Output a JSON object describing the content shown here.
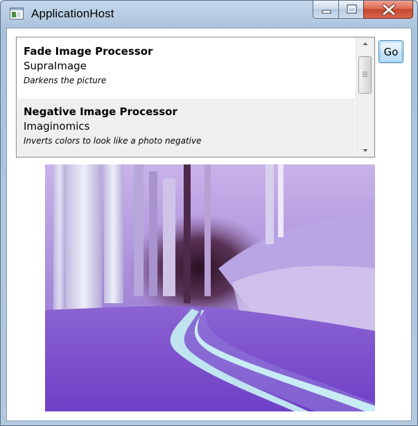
{
  "window": {
    "title": "ApplicationHost",
    "icon": "application-window-icon",
    "caption_buttons": [
      "minimize-icon",
      "maximize-icon",
      "close-icon"
    ],
    "close_color": "#c4452e"
  },
  "processors": [
    {
      "name": "Fade Image Processor",
      "vendor": "SupraImage",
      "description": "Darkens the picture"
    },
    {
      "name": "Negative Image Processor",
      "vendor": "Imaginomics",
      "description": "Inverts colors to look like a photo negative"
    }
  ],
  "selected_index": 1,
  "go_button": {
    "label": "Go"
  },
  "preview": {
    "icon": "negative-forest-road-image",
    "accent": "#7a5cd6"
  }
}
